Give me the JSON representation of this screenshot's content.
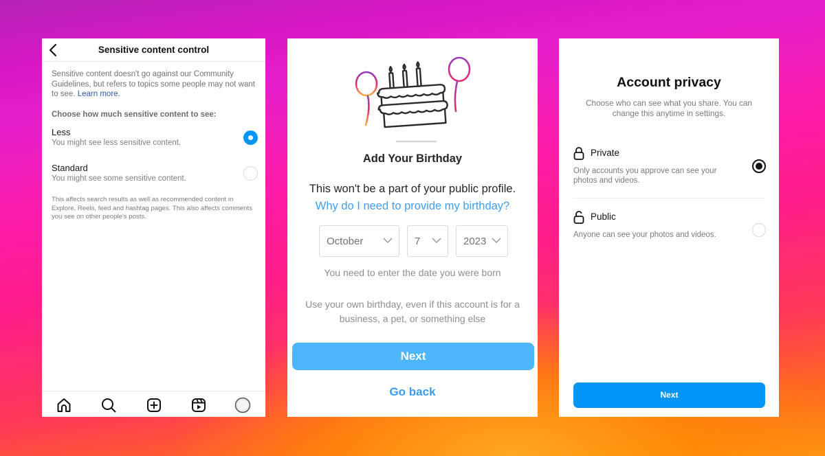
{
  "sensitive_panel": {
    "title": "Sensitive content control",
    "intro_text": "Sensitive content doesn't go against our Community Guidelines, but refers to topics some people may not want to see.",
    "learn_more": "Learn more.",
    "choose_label": "Choose how much sensitive content to see:",
    "options": [
      {
        "label": "Less",
        "description": "You might see less sensitive content.",
        "selected": true
      },
      {
        "label": "Standard",
        "description": "You might see some sensitive content.",
        "selected": false
      }
    ],
    "note": "This affects search results as well as recommended content in Explore, Reels, feed and hashtag pages. This also affects comments you see on other people's posts.",
    "nav_icons": [
      "home-icon",
      "search-icon",
      "create-icon",
      "reels-icon",
      "profile-avatar"
    ]
  },
  "birthday_panel": {
    "title": "Add Your Birthday",
    "public_note": "This won't be a part of your public profile.",
    "why_link": "Why do I need to provide my birthday?",
    "month": "October",
    "day": "7",
    "year": "2023",
    "need_text": "You need to enter the date you were born",
    "use_text": "Use your own birthday, even if this account is for a business, a pet, or something else",
    "next_label": "Next",
    "back_label": "Go back"
  },
  "privacy_panel": {
    "title": "Account privacy",
    "subtitle": "Choose who can see what you share. You can change this anytime in settings.",
    "options": [
      {
        "label": "Private",
        "description": "Only accounts you approve can see your photos and videos.",
        "selected": true,
        "icon": "lock-icon"
      },
      {
        "label": "Public",
        "description": "Anyone can see your photos and videos.",
        "selected": false,
        "icon": "unlock-icon"
      }
    ],
    "next_label": "Next"
  },
  "colors": {
    "accent_blue": "#0095f6",
    "link_blue": "#3f9ef1",
    "next_light_blue": "#4db5f9"
  }
}
